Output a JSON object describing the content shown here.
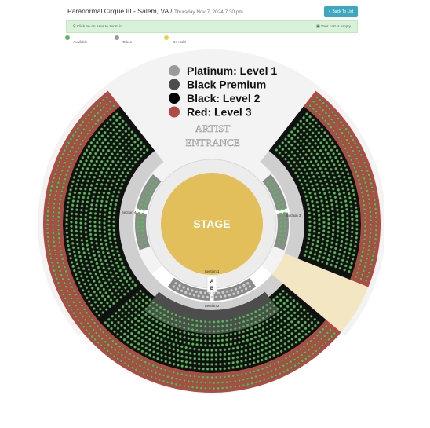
{
  "header": {
    "title": "Paranormal Cirque III - Salem, VA /",
    "date": "Thursday Nov 7, 2024 7:30 pm",
    "back_label": "Back To List"
  },
  "info_bar": {
    "left_text": "Click on an area to zoom in",
    "right_text": "Your cart is empty"
  },
  "status_legend": [
    {
      "label": "Available",
      "color": "#5cb85c"
    },
    {
      "label": "Taken",
      "color": "#999999"
    },
    {
      "label": "On Hold",
      "color": "#e8d440"
    }
  ],
  "price_legend": [
    {
      "label": "Platinum: Level 1",
      "color": "#9a9a9a"
    },
    {
      "label": "Black Premium",
      "color": "#4d4d4d"
    },
    {
      "label": "Black: Level 2",
      "color": "#000000"
    },
    {
      "label": "Red: Level 3",
      "color": "#b04a44"
    }
  ],
  "map": {
    "artist_entrance_line1": "ARTIST",
    "artist_entrance_line2": "ENTRANCE",
    "stage_label": "STAGE",
    "section_labels": [
      "Section 1",
      "Section 2",
      "Section 3",
      "Section 4"
    ],
    "aisle_labels": [
      "A",
      "B"
    ],
    "colors": {
      "available": "#5cb85c",
      "red_band": "#b04a44",
      "black_band": "#111111",
      "premium_band": "#4d4d4d",
      "platinum_band": "#9a9a9a",
      "stage": "#e2bf5a",
      "floor": "#f3f3f3",
      "cream": "#f3e7c3"
    }
  }
}
